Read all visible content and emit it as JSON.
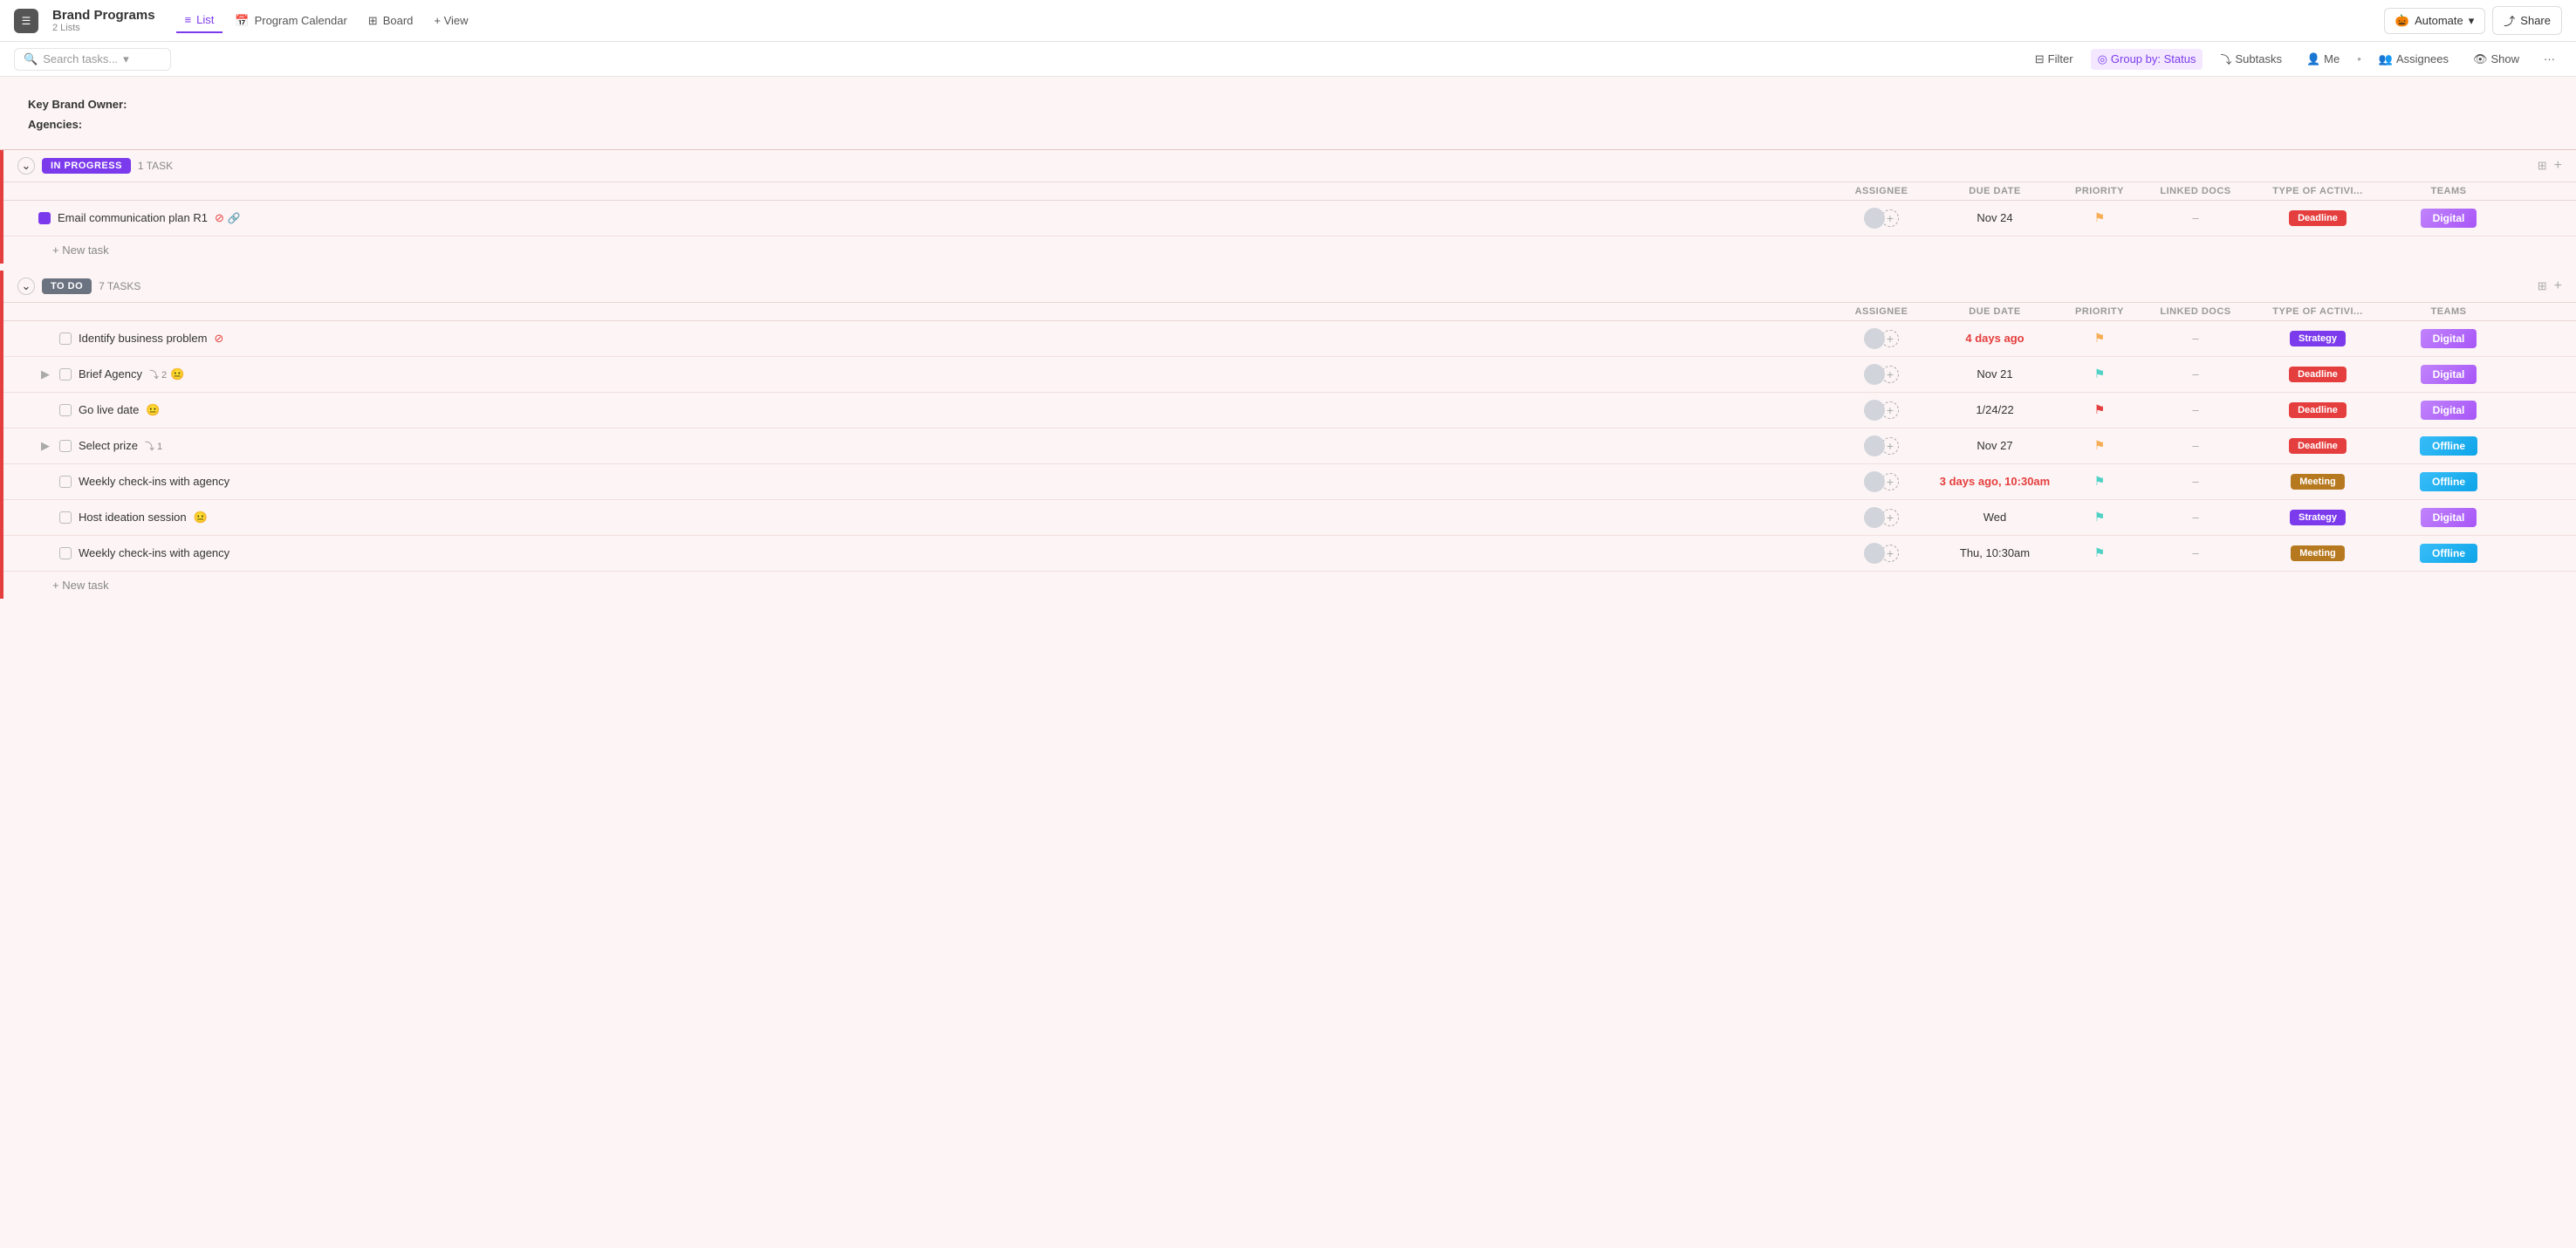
{
  "app": {
    "icon": "☰",
    "project_title": "Brand Programs",
    "project_sub": "2 Lists"
  },
  "nav": {
    "tabs": [
      {
        "id": "list",
        "label": "List",
        "icon": "≡",
        "active": true
      },
      {
        "id": "calendar",
        "label": "Program Calendar",
        "icon": "📅",
        "active": false
      },
      {
        "id": "board",
        "label": "Board",
        "icon": "⊞",
        "active": false
      },
      {
        "id": "view",
        "label": "+ View",
        "icon": "",
        "active": false
      }
    ]
  },
  "header_actions": {
    "automate_label": "Automate",
    "share_label": "Share"
  },
  "toolbar": {
    "search_placeholder": "Search tasks...",
    "filter_label": "Filter",
    "group_by_label": "Group by: Status",
    "subtasks_label": "Subtasks",
    "me_label": "Me",
    "assignees_label": "Assignees",
    "show_label": "Show",
    "more_label": "···"
  },
  "info_panel": {
    "line1": "Key Brand Owner:",
    "line2": "Agencies:"
  },
  "sections": [
    {
      "id": "in-progress",
      "status": "IN PROGRESS",
      "status_class": "in-progress",
      "task_count": "1 TASK",
      "col_headers": [
        "ASSIGNEE",
        "DUE DATE",
        "PRIORITY",
        "LINKED DOCS",
        "TYPE OF ACTIVI...",
        "TEAMS"
      ],
      "tasks": [
        {
          "id": "t1",
          "name": "Email communication plan R1",
          "checkbox_filled": true,
          "has_stop": true,
          "has_clip": true,
          "assignee_initials": "",
          "due_date": "Nov 24",
          "due_overdue": false,
          "priority": "yellow",
          "linked": "–",
          "type": "Deadline",
          "type_class": "deadline",
          "team": "Digital",
          "team_class": "digital",
          "expand": false,
          "subtask_count": null
        }
      ],
      "new_task_label": "+ New task"
    },
    {
      "id": "todo",
      "status": "TO DO",
      "status_class": "todo",
      "task_count": "7 TASKS",
      "col_headers": [
        "ASSIGNEE",
        "DUE DATE",
        "PRIORITY",
        "LINKED DOCS",
        "TYPE OF ACTIVI...",
        "TEAMS"
      ],
      "tasks": [
        {
          "id": "t2",
          "name": "Identify business problem",
          "checkbox_filled": false,
          "has_stop": true,
          "has_clip": false,
          "assignee_initials": "",
          "due_date": "4 days ago",
          "due_overdue": true,
          "priority": "yellow",
          "linked": "–",
          "type": "Strategy",
          "type_class": "strategy",
          "team": "Digital",
          "team_class": "digital",
          "expand": false,
          "subtask_count": null,
          "emoji": null
        },
        {
          "id": "t3",
          "name": "Brief Agency",
          "checkbox_filled": false,
          "has_stop": false,
          "has_clip": false,
          "assignee_initials": "",
          "due_date": "Nov 21",
          "due_overdue": false,
          "priority": "cyan",
          "linked": "–",
          "type": "Deadline",
          "type_class": "deadline",
          "team": "Digital",
          "team_class": "digital",
          "expand": true,
          "subtask_count": "2",
          "emoji": "😐"
        },
        {
          "id": "t4",
          "name": "Go live date",
          "checkbox_filled": false,
          "has_stop": false,
          "has_clip": false,
          "assignee_initials": "",
          "due_date": "1/24/22",
          "due_overdue": false,
          "priority": "red",
          "linked": "–",
          "type": "Deadline",
          "type_class": "deadline",
          "team": "Digital",
          "team_class": "digital",
          "expand": false,
          "subtask_count": null,
          "emoji": "😐"
        },
        {
          "id": "t5",
          "name": "Select prize",
          "checkbox_filled": false,
          "has_stop": false,
          "has_clip": false,
          "assignee_initials": "",
          "due_date": "Nov 27",
          "due_overdue": false,
          "priority": "yellow",
          "linked": "–",
          "type": "Deadline",
          "type_class": "deadline",
          "team": "Offline",
          "team_class": "offline",
          "expand": true,
          "subtask_count": "1",
          "emoji": null
        },
        {
          "id": "t6",
          "name": "Weekly check-ins with agency",
          "checkbox_filled": false,
          "has_stop": false,
          "has_clip": false,
          "assignee_initials": "",
          "due_date": "3 days ago, 10:30am",
          "due_overdue": true,
          "priority": "cyan",
          "linked": "–",
          "type": "Meeting",
          "type_class": "meeting",
          "team": "Offline",
          "team_class": "offline",
          "expand": false,
          "subtask_count": null,
          "emoji": null
        },
        {
          "id": "t7",
          "name": "Host ideation session",
          "checkbox_filled": false,
          "has_stop": false,
          "has_clip": false,
          "assignee_initials": "",
          "due_date": "Wed",
          "due_overdue": false,
          "priority": "cyan",
          "linked": "–",
          "type": "Strategy",
          "type_class": "strategy",
          "team": "Digital",
          "team_class": "digital",
          "expand": false,
          "subtask_count": null,
          "emoji": "😐"
        },
        {
          "id": "t8",
          "name": "Weekly check-ins with agency",
          "checkbox_filled": false,
          "has_stop": false,
          "has_clip": false,
          "assignee_initials": "",
          "due_date": "Thu, 10:30am",
          "due_overdue": false,
          "priority": "cyan",
          "linked": "–",
          "type": "Meeting",
          "type_class": "meeting",
          "team": "Offline",
          "team_class": "offline",
          "expand": false,
          "subtask_count": null,
          "emoji": null
        }
      ],
      "new_task_label": "+ New task"
    }
  ]
}
